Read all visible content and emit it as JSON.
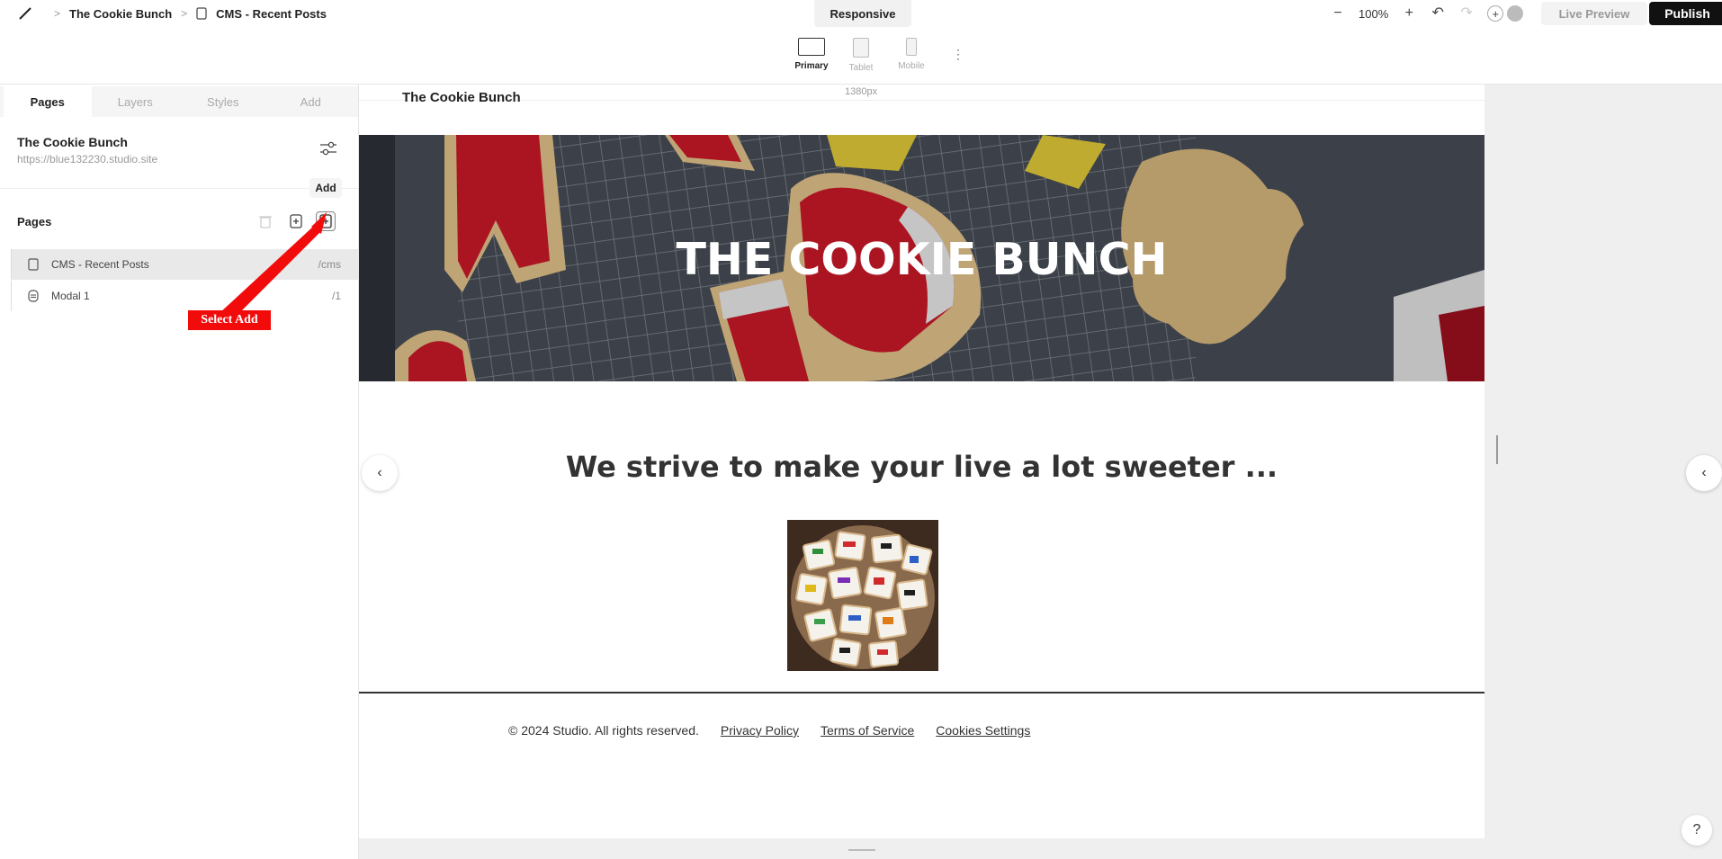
{
  "topbar": {
    "breadcrumb": [
      "The Cookie Bunch",
      "CMS - Recent Posts"
    ],
    "responsive_tab": "Responsive",
    "zoom_level": "100%",
    "live_preview": "Live Preview",
    "publish": "Publish"
  },
  "devices": [
    {
      "label": "Primary",
      "active": true
    },
    {
      "label": "Tablet",
      "active": false
    },
    {
      "label": "Mobile",
      "active": false
    }
  ],
  "sidebar": {
    "tabs": [
      "Pages",
      "Layers",
      "Styles",
      "Add"
    ],
    "site_name": "The Cookie Bunch",
    "site_url": "https://blue132230.studio.site",
    "tooltip": "Add",
    "pages_heading": "Pages",
    "pages": [
      {
        "name": "CMS - Recent Posts",
        "path": "/cms",
        "icon": "page-icon"
      },
      {
        "name": "Modal 1",
        "path": "/1",
        "icon": "modal-icon"
      }
    ]
  },
  "annotation": {
    "label": "Select Add",
    "color": "#f20b0b"
  },
  "canvas": {
    "site_logo": "The Cookie Bunch",
    "width_label": "1380px",
    "hero_title": "THE COOKIE BUNCH",
    "tagline": "We strive to make your live a lot sweeter ...",
    "footer": {
      "copyright": "© 2024 Studio. All rights reserved.",
      "links": [
        "Privacy Policy",
        "Terms of Service",
        "Cookies Settings"
      ]
    }
  },
  "help_label": "?"
}
